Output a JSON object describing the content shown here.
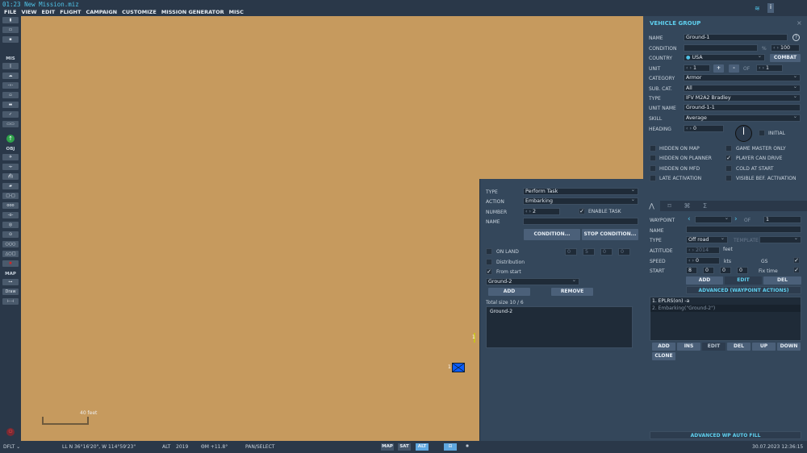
{
  "title": "01:23  New Mission.miz",
  "menu": [
    "FILE",
    "VIEW",
    "EDIT",
    "FLIGHT",
    "CAMPAIGN",
    "CUSTOMIZE",
    "MISSION GENERATOR",
    "MISC"
  ],
  "toolbar": {
    "mis_label": "MIS",
    "obj_label": "OBJ",
    "map_label": "MAP",
    "draw_label": "Draw"
  },
  "map": {
    "scale_label": "40 feet",
    "unit_marker_label": "1",
    "waypoint_label": "1",
    "unit_color": "#0a5cff",
    "terrain_color": "#c69a5e"
  },
  "vehicle_group": {
    "header": "VEHICLE GROUP",
    "close": "×",
    "name_label": "NAME",
    "name": "Ground-1",
    "help": "?",
    "condition_label": "CONDITION",
    "condition": "",
    "percent": "%",
    "condition_pct": "100",
    "country_label": "COUNTRY",
    "country": "USA",
    "combat_label": "COMBAT",
    "unit_label": "UNIT",
    "unit": "1",
    "plus": "+",
    "minus": "-",
    "of_label": "OF",
    "unit_of": "1",
    "category_label": "CATEGORY",
    "category": "Armor",
    "subcat_label": "SUB. CAT.",
    "subcat": "All",
    "type_label": "TYPE",
    "type": "IFV M2A2 Bradley",
    "unitname_label": "UNIT NAME",
    "unitname": "Ground-1-1",
    "skill_label": "SKILL",
    "skill": "Average",
    "heading_label": "HEADING",
    "heading": "0",
    "initial_label": "INITIAL",
    "checks": [
      {
        "label": "HIDDEN ON MAP",
        "checked": false
      },
      {
        "label": "GAME MASTER ONLY",
        "checked": false
      },
      {
        "label": "HIDDEN ON PLANNER",
        "checked": false
      },
      {
        "label": "PLAYER CAN DRIVE",
        "checked": true
      },
      {
        "label": "HIDDEN ON MFD",
        "checked": false
      },
      {
        "label": "COLD AT START",
        "checked": false
      },
      {
        "label": "LATE ACTIVATION",
        "checked": false
      },
      {
        "label": "VISIBLE BEF. ACTIVATION",
        "checked": false
      }
    ]
  },
  "waypoint": {
    "waypoint_label": "WAYPOINT",
    "waypoint": "",
    "of_label": "OF",
    "of": "1",
    "name_label": "NAME",
    "name": "",
    "type_label": "TYPE",
    "type": "Off road",
    "template_label": "TEMPLATE",
    "template": "",
    "altitude_label": "ALTITUDE",
    "altitude": "2014",
    "alt_unit": "feet",
    "speed_label": "SPEED",
    "speed": "0",
    "speed_unit": "kts",
    "gs_label": "GS",
    "gs_checked": true,
    "start_label": "START",
    "start_h": "8",
    "start_m": "0",
    "start_s": "0",
    "start_d": "0",
    "fix_time_label": "Fix time",
    "fix_time_checked": true,
    "add": "ADD",
    "edit": "EDIT",
    "del": "DEL",
    "advanced": "ADVANCED (WAYPOINT ACTIONS)",
    "actions": [
      "1. EPLRS(on) -a",
      "2. Embarking(\"Ground-2\")"
    ],
    "list_buttons": [
      "ADD",
      "INS",
      "EDIT",
      "DEL",
      "UP",
      "DOWN",
      "CLONE"
    ],
    "autofill": "ADVANCED WP AUTO FILL"
  },
  "task": {
    "type_label": "TYPE",
    "type": "Perform Task",
    "action_label": "ACTION",
    "action": "Embarking",
    "number_label": "NUMBER",
    "number": "2",
    "enable_label": "ENABLE TASK",
    "enable_checked": true,
    "name_label": "NAME",
    "name": "",
    "condition": "CONDITION...",
    "stop_condition": "STOP CONDITION...",
    "on_land_label": "ON LAND",
    "time": [
      "0",
      "5",
      "0",
      "0"
    ],
    "distribution_label": "Distribution",
    "from_start_label": "From start",
    "from_start_checked": true,
    "group_select": "Ground-2",
    "add": "ADD",
    "remove": "REMOVE",
    "total_size": "Total size 10 / 6",
    "groups": [
      "Ground-2"
    ]
  },
  "status": {
    "mode": "DFLT",
    "coords": "LL  N 36°16'20\", W 114°59'23\"",
    "alt_label": "ALT",
    "alt": "2019",
    "mag": "ΘM  +11.8°",
    "tool": "PAN/SELECT",
    "map_btn": "MAP",
    "sat_btn": "SAT",
    "alt_btn": "ALT",
    "active_view": "ALT",
    "datetime": "30.07.2023 12:36:15"
  }
}
